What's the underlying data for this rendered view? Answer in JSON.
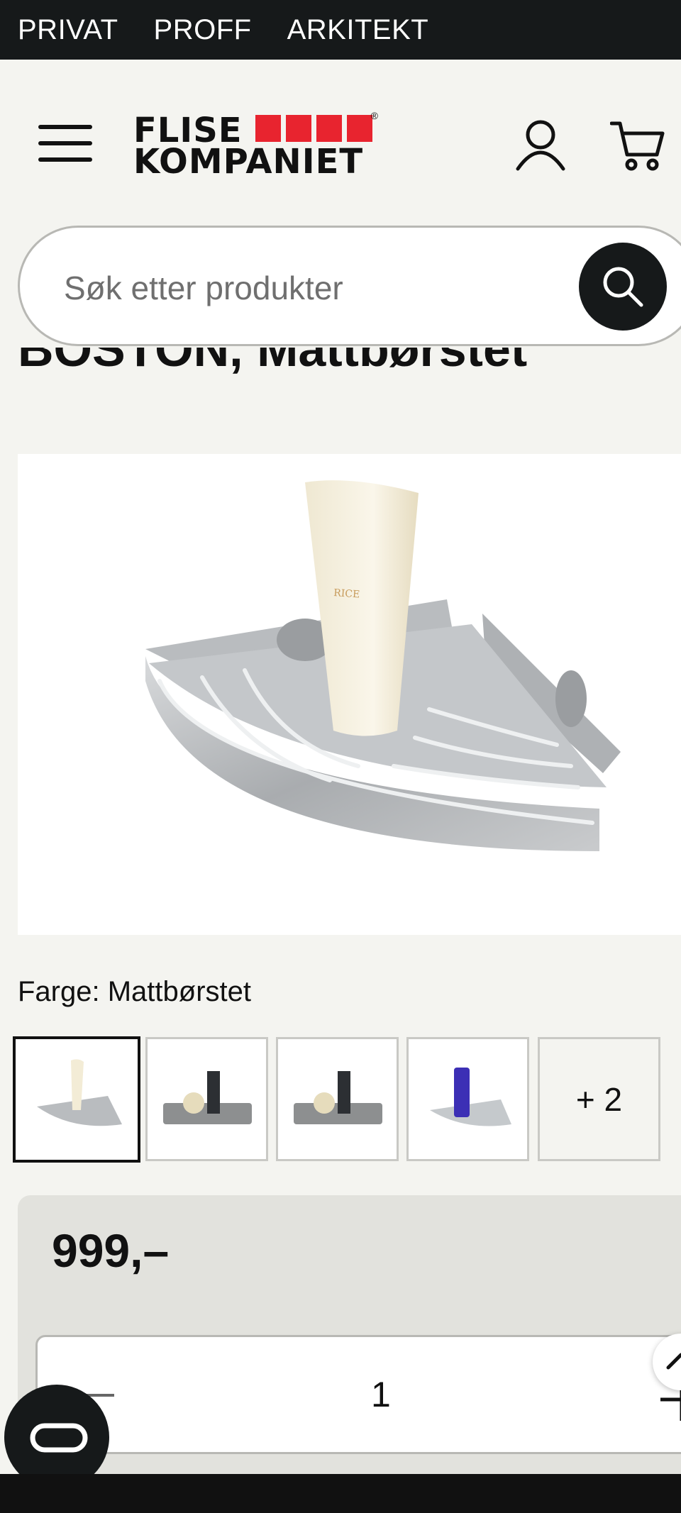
{
  "topnav": {
    "items": [
      "PRIVAT",
      "PROFF",
      "ARKITEKT"
    ]
  },
  "header": {
    "logo_line1": "FLISE",
    "logo_line2": "KOMPANIET",
    "logo_reg": "®",
    "brand_color": "#e8242f",
    "icons": [
      "menu-icon",
      "user-icon",
      "cart-icon"
    ]
  },
  "search": {
    "placeholder": "Søk etter produkter",
    "icon": "search-icon"
  },
  "product": {
    "title_partial": "BOSTON, Mattbørstet",
    "image_desc": "corner-shelf-photo",
    "color_label": "Farge: Mattbørstet",
    "thumbnails_more": "+ 2",
    "price": "999,–",
    "quantity": "1"
  },
  "colors": {
    "dark": "#16191a",
    "page_bg": "#f4f4f0",
    "price_bg": "#e2e2dd"
  }
}
